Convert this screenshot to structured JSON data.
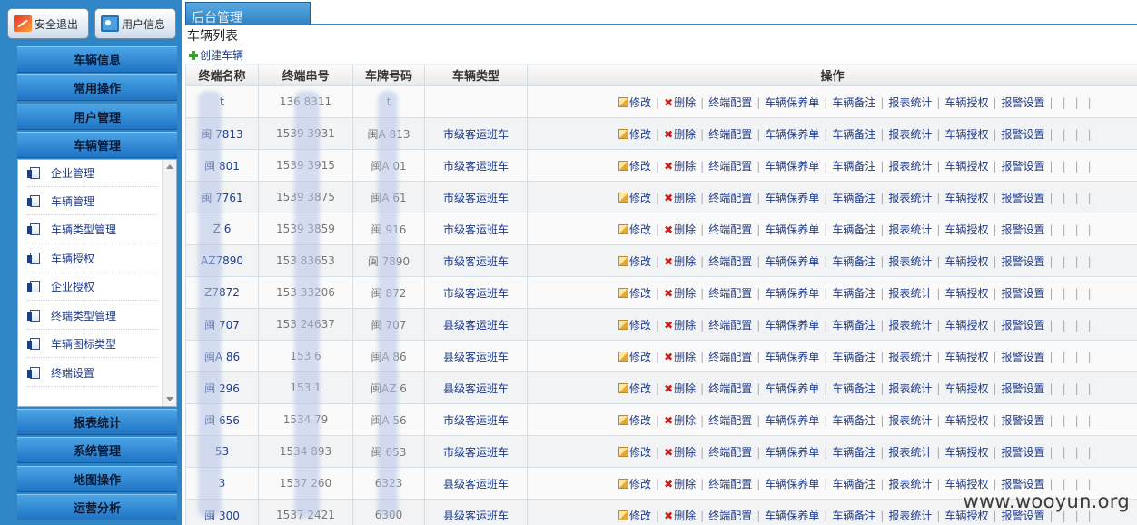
{
  "topbar": {
    "logout_label": "安全退出",
    "userinfo_label": "用户信息"
  },
  "menu": {
    "sections_top": [
      "车辆信息",
      "常用操作",
      "用户管理",
      "车辆管理"
    ],
    "sub_items": [
      "企业管理",
      "车辆管理",
      "车辆类型管理",
      "车辆授权",
      "企业授权",
      "终端类型管理",
      "车辆图标类型",
      "终端设置"
    ],
    "sections_bottom": [
      "报表统计",
      "系统管理",
      "地图操作",
      "运营分析"
    ]
  },
  "tab": {
    "label": "后台管理"
  },
  "page": {
    "title": "车辆列表",
    "create_label": "创建车辆"
  },
  "table": {
    "headers": [
      "终端名称",
      "终端串号",
      "车牌号码",
      "车辆类型",
      "操作"
    ],
    "rows": [
      [
        "t",
        "136 8311",
        "t",
        ""
      ],
      [
        "闽 7813",
        "1539 3931",
        "闽A 813",
        "市级客运班车"
      ],
      [
        "闽 801",
        "1539 3915",
        "闽A 01",
        "市级客运班车"
      ],
      [
        "闽 7761",
        "1539 3875",
        "闽A 61",
        "市级客运班车"
      ],
      [
        "Z 6",
        "1539 3859",
        "闽 916",
        "市级客运班车"
      ],
      [
        "AZ7890",
        "153 83653",
        "闽 7890",
        "市级客运班车"
      ],
      [
        "Z7872",
        "153 33206",
        "闽 872",
        "市级客运班车"
      ],
      [
        "闽 707",
        "153 24637",
        "闽 707",
        "县级客运班车"
      ],
      [
        "闽A 86",
        "153 6",
        "闽A 86",
        "县级客运班车"
      ],
      [
        "闽 296",
        "153 1",
        "闽AZ 6",
        "县级客运班车"
      ],
      [
        "闽 656",
        "1534 79",
        "闽A 56",
        "市级客运班车"
      ],
      [
        "53",
        "1534 893",
        "闽 653",
        "市级客运班车"
      ],
      [
        "3",
        "1537 260",
        "6323",
        "县级客运班车"
      ],
      [
        "闽 300",
        "1537 2421",
        "6300",
        "县级客运班车"
      ]
    ],
    "ops": {
      "edit": "修改",
      "delete": "删除",
      "links": [
        "终端配置",
        "车辆保养单",
        "车辆备注",
        "报表统计",
        "车辆授权",
        "报警设置"
      ]
    }
  },
  "watermark": "www.wooyun.org"
}
